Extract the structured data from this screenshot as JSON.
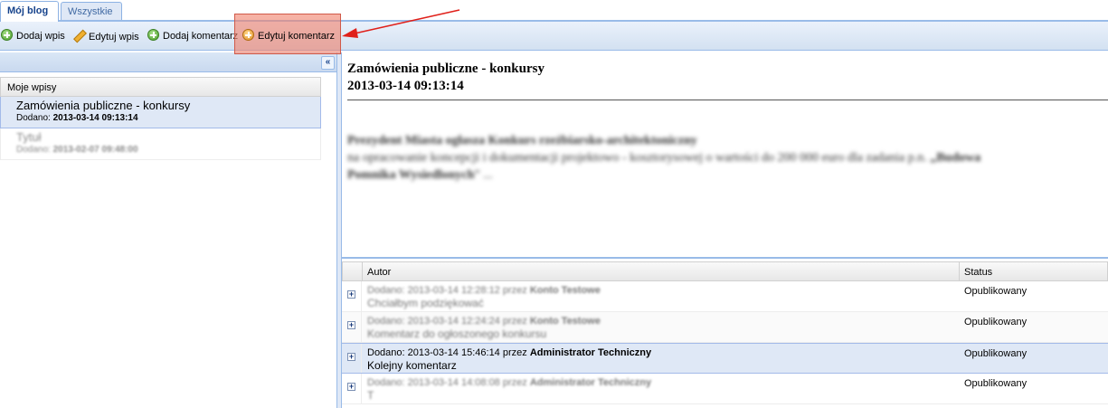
{
  "tabs": [
    {
      "label": "Mój blog",
      "active": true
    },
    {
      "label": "Wszystkie",
      "active": false
    }
  ],
  "toolbar": {
    "add_post": "Dodaj wpis",
    "edit_post": "Edytuj wpis",
    "add_comment": "Dodaj komentarz",
    "edit_comment": "Edytuj komentarz"
  },
  "left_panel": {
    "collapse_glyph": "«",
    "column_header": "Moje wpisy",
    "items": [
      {
        "title": "Zamówienia publiczne - konkursy",
        "added_label": "Dodano:",
        "date": "2013-03-14 09:13:14",
        "selected": true
      },
      {
        "title": "Tytuł",
        "added_label": "Dodano:",
        "date": "2013-02-07 09:48:00",
        "selected": false
      }
    ]
  },
  "post": {
    "title": "Zamówienia publiczne - konkursy",
    "date": "2013-03-14 09:13:14",
    "body_line1": "Prezydent Miasta ogłasza Konkurs rzeźbiarsko-architektoniczny",
    "body_line2_a": "na opracowanie koncepcji i dokumentacji projektowo - kosztorysowej o wartości do 200 000 euro dla zadania p.n. ",
    "body_line2_b": "„Budowa",
    "body_line3_b": "Pomnika Wysiedlonych",
    "body_line3_c": "” ..."
  },
  "comments": {
    "columns": {
      "author": "Autor",
      "status": "Status"
    },
    "expander_glyph": "+",
    "rows": [
      {
        "added_label": "Dodano:",
        "date": "2013-03-14 12:28:12",
        "by_label": "przez",
        "author": "Konto Testowe",
        "text": "Chciałbym podziękować",
        "status": "Opublikowany",
        "selected": false
      },
      {
        "added_label": "Dodano:",
        "date": "2013-03-14 12:24:24",
        "by_label": "przez",
        "author": "Konto Testowe",
        "text": "Komentarz do ogłoszonego konkursu",
        "status": "Opublikowany",
        "selected": false
      },
      {
        "added_label": "Dodano:",
        "date": "2013-03-14 15:46:14",
        "by_label": "przez",
        "author": "Administrator Techniczny",
        "text": "Kolejny komentarz",
        "status": "Opublikowany",
        "selected": true
      },
      {
        "added_label": "Dodano:",
        "date": "2013-03-14 14:08:08",
        "by_label": "przez",
        "author": "Administrator Techniczny",
        "text": "T",
        "status": "Opublikowany",
        "selected": false
      }
    ]
  },
  "colors": {
    "accent": "#15428b",
    "highlight": "#f0826e",
    "arrow": "#e0201a",
    "selection": "#dfe8f6"
  }
}
